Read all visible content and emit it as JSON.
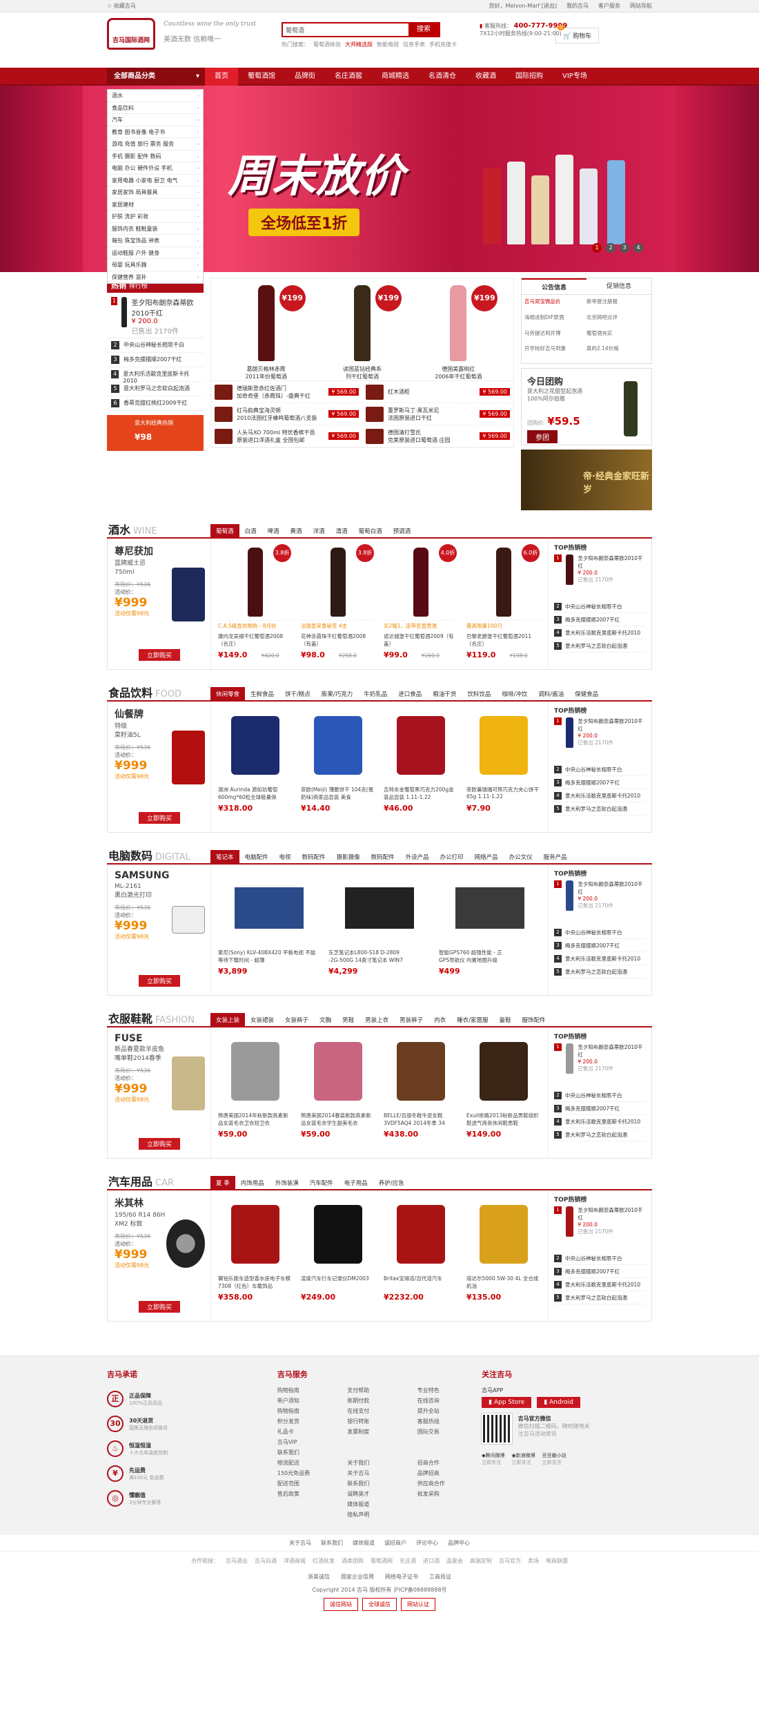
{
  "topbar": {
    "fav": "收藏吉马",
    "links": [
      "您好，Melvon-Marf [退出]",
      "我的吉马",
      "客户服务",
      "网站导航"
    ]
  },
  "header": {
    "logo": "吉马国际酒网",
    "slogan": "Countless wine the only trust",
    "slogan2": "美酒无数 信赖唯一",
    "search_value": "葡萄酒",
    "search_btn": "搜索",
    "hot_label": "热门搜索：",
    "hot": [
      "葡萄酒体验",
      "大师精选版",
      "智能电视",
      "信息手表",
      "手机充值卡"
    ],
    "phone_label": "客服热线：",
    "phone": "400-777-9999",
    "phone_time": "7X12小时服务热线(9:00-21:00)",
    "cart": "购物车",
    "cart_count": "0"
  },
  "nav": {
    "cat": "全部商品分类",
    "items": [
      "首页",
      "葡萄酒馆",
      "品牌街",
      "名庄酒窖",
      "商城精选",
      "名酒清仓",
      "收藏酒",
      "国际招购",
      "VIP专场"
    ]
  },
  "categories": [
    "酒水",
    "食品饮料",
    "汽车",
    "教育 图书音像 电子书",
    "游戏 充值 旅行 票务 服务",
    "手机 摄影 配件 数码",
    "电脑 办公 硬件外设 手机",
    "家用电器 小家电 厨卫 电气",
    "家居家饰 局具餐具",
    "家居建材",
    "护肤 洗护 彩妆",
    "服饰内衣 鞋靴童装",
    "箱包 珠宝饰品 钟表",
    "运动鞋服 户外 健身",
    "母婴 玩具乐器",
    "保健营养 滋补"
  ],
  "banner": {
    "title": "周末放价",
    "sub": "全场低至1折",
    "dots": [
      "1",
      "2",
      "3",
      "4"
    ]
  },
  "rank": {
    "title": "热销",
    "title2": "排行榜",
    "first": {
      "name": "圣夕阳布朗奈森蒂欧2010干红",
      "price": "¥ 200.0",
      "sold": "已售出 2170件"
    },
    "items": [
      "中央山谷神秘长相思干白",
      "梅多克摆摆顺2007干红",
      "意大利乐活歌克里底斯卡托2010",
      "意大利罗马之恋软白起泡酒",
      "香蒂克甜红桃红2009干红"
    ],
    "promo_title": "意大利经典热销",
    "promo_price": "¥98"
  },
  "promo": {
    "main": [
      {
        "price": "¥199",
        "name": "葛朗贝格林赤霞\n2011年份葡萄酒"
      },
      {
        "price": "¥199",
        "name": "读国蓝钻经典系\n列干红葡萄酒"
      },
      {
        "price": "¥199",
        "name": "德国美露桃红\n2006年干红葡萄酒"
      }
    ],
    "small": [
      {
        "name": "德瑞斯登赤红佐酒门\n加奇奇堡（赤霞珠）-盛典干红",
        "price": "¥ 569.00"
      },
      {
        "name": "红木酒柜",
        "price": "¥ 569.00"
      },
      {
        "name": "红马韵典宝海灵顿\n2010法国红牙蜂鸣葡萄酒八支装",
        "price": "¥ 569.00"
      },
      {
        "name": "董罗斯马丁·黑瓦米尼\n法国原装进口干红",
        "price": "¥ 569.00"
      },
      {
        "name": "人头马XO 700ml 特优香槟干邑\n原装进口洋酒礼盒 全国包邮",
        "price": "¥ 569.00"
      },
      {
        "name": "德国清打雪氏\n克莱原装进口葡萄酒 庄园",
        "price": "¥ 569.00"
      }
    ]
  },
  "side": {
    "tabs": [
      "公告信息",
      "促销信息"
    ],
    "news": [
      "吉马双宝微品价",
      "新帝登注册报",
      "海棉进制DIF原酒",
      "北京网吧点评",
      "马劳提达到开博",
      "葡萄酒充实",
      "开学校好吉马到惠",
      "真的2.14价格"
    ],
    "tuan_title": "今日团购",
    "tuan_desc": "意大利之花甜型起泡酒\n100%阿尔伯雅",
    "tuan_label": "团购价",
    "tuan_price": "¥59.5",
    "tuan_btn": "参团",
    "gold": "帝·经典金家旺新岁"
  },
  "sections": [
    {
      "title": "酒水",
      "en": "WINE",
      "tabs": [
        "葡萄酒",
        "白酒",
        "啤酒",
        "黄酒",
        "洋酒",
        "清酒",
        "葡萄白酒",
        "预调酒"
      ],
      "feat": {
        "name": "尊尼获加",
        "desc": "蓝牌威士忌\n750ml",
        "market": "市场价：¥536",
        "act": "活动价：",
        "price": "¥999",
        "note": "活动仅需98元"
      },
      "buy": "立即购买",
      "goods": [
        {
          "badge": "3.8折",
          "desc": "康内龙吴裙干红葡萄酒2008（名庄）",
          "price": "¥149.0",
          "old": "¥420.0",
          "ad": "C.A.S级直供限购 - 8月份"
        },
        {
          "badge": "3.8折",
          "desc": "花神赤霞珠干红葡萄酒2008（有盖）",
          "price": "¥98.0",
          "old": "¥258.0",
          "ad": "法国直采意秘芳 4支"
        },
        {
          "badge": "4.0折",
          "desc": "诺达城堡干红葡萄酒2009（有盖）",
          "price": "¥99.0",
          "old": "¥260.0",
          "ad": "买2赠1，连带至直营酒"
        },
        {
          "badge": "6.0折",
          "desc": "巴黎老爵堡干红葡萄酒2011（名庄）",
          "price": "¥119.0",
          "old": "¥198.0",
          "ad": "最高限量100只"
        }
      ],
      "top": {
        "name": "圣夕阳布朗奈森蒂欧2010干红",
        "price": "¥ 200.0",
        "sold": "已售出 2170件",
        "items": [
          "中央山谷神秘长相思干白",
          "梅多克摆摆顺2007干红",
          "意大利乐活歌克里底斯卡托2010",
          "意大利罗马之恋软白起泡酒"
        ]
      }
    },
    {
      "title": "食品饮料",
      "en": "FOOD",
      "tabs": [
        "休闲零食",
        "生鲜食品",
        "饼干/糕点",
        "膨果/巧克力",
        "牛奶乳品",
        "进口食品",
        "粮油干货",
        "饮料饮品",
        "咖啡/冲饮",
        "调料/酱油",
        "保健食品"
      ],
      "feat": {
        "name": "仙餐牌",
        "desc": "特级\n菜籽油5L",
        "market": "市场价：¥536",
        "act": "活动价：",
        "price": "¥999",
        "note": "活动仅需98元"
      },
      "buy": "立即购买",
      "goods": [
        {
          "badge": "",
          "desc": "澳洲 Aurinda 源如坊葡萄 600mg*60粒全球极量保",
          "price": "¥318.00",
          "old": "",
          "ad": ""
        },
        {
          "badge": "",
          "desc": "菲欧(Meiji) 薄脆饼干 104克(蛋奶味)商家品尝装 美食",
          "price": "¥14.40",
          "old": "",
          "ad": ""
        },
        {
          "badge": "",
          "desc": "吉特本金葡萄黑巧克力200g盒装品尝装 1.11-1.22",
          "price": "¥46.00",
          "old": "",
          "ad": ""
        },
        {
          "badge": "",
          "desc": "菲欧兼瑞瑞可熊巧克力夹心饼干 65g 1.11-1.22",
          "price": "¥7.90",
          "old": "",
          "ad": ""
        }
      ],
      "top": {
        "name": "圣夕阳布朗奈森蒂欧2010干红",
        "price": "¥ 200.0",
        "sold": "已售出 2170件",
        "items": [
          "中央山谷神秘长相思干白",
          "梅多克摆摆顺2007干红",
          "意大利乐活歌克里底斯卡托2010",
          "意大利罗马之恋软白起泡酒"
        ]
      }
    },
    {
      "title": "电脑数码",
      "en": "DIGITAL",
      "tabs": [
        "笔记本",
        "电脑配件",
        "电视",
        "数码配件",
        "摄影摄像",
        "数码配件",
        "外设产品",
        "办公打印",
        "网络产品",
        "办公文仪",
        "服务产品"
      ],
      "feat": {
        "name": "SAMSUNG",
        "desc": "ML-2161\n黑白激光打印",
        "market": "市场价：¥536",
        "act": "活动价：",
        "price": "¥999",
        "note": "活动仅需98元"
      },
      "buy": "立即购买",
      "goods": [
        {
          "badge": "",
          "desc": "索尼(Sony) KLV-40BX420 平板电视 不能等待下载时间 - 超薄",
          "price": "¥3,899",
          "old": "",
          "ad": ""
        },
        {
          "badge": "",
          "desc": "东芝笔记本L800-S18 D-2809\n-2G-500G 14英寸笔记本 WIN7",
          "price": "¥4,299",
          "old": "",
          "ad": ""
        },
        {
          "badge": "",
          "desc": "智能GPS760 超强性能 - 正\nGPS导航仪 内置地图升级",
          "price": "¥499",
          "old": "",
          "ad": ""
        }
      ],
      "top": {
        "name": "圣夕阳布朗奈森蒂欧2010干红",
        "price": "¥ 200.0",
        "sold": "已售出 2170件",
        "items": [
          "中央山谷神秘长相思干白",
          "梅多克摆摆顺2007干红",
          "意大利乐活歌克里底斯卡托2010",
          "意大利罗马之恋软白起泡酒"
        ]
      }
    },
    {
      "title": "衣服鞋靴",
      "en": "FASHION",
      "tabs": [
        "女装上装",
        "女装裙装",
        "女装裤子",
        "文胸",
        "男鞋",
        "男装上衣",
        "男装裤子",
        "内衣",
        "睡衣/家居服",
        "童鞋",
        "服饰配件"
      ],
      "feat": {
        "name": "FUSE",
        "desc": "新品春夏款羊皮鱼\n嘴单鞋2014春季",
        "market": "市场价：¥536",
        "act": "活动价：",
        "price": "¥999",
        "note": "活动仅需98元"
      },
      "buy": "立即购买",
      "goods": [
        {
          "badge": "",
          "desc": "熊唐美国2014年秋新款高素新品女装毛衣卫衣短卫衣",
          "price": "¥59.00",
          "old": "",
          "ad": ""
        },
        {
          "badge": "",
          "desc": "熊唐美国2014春装新款高素新品女装毛衣学生甜美毛衣",
          "price": "¥59.00",
          "old": "",
          "ad": ""
        },
        {
          "badge": "",
          "desc": "BELLE/百丽冬靴牛皮女靴3VDF5AQ4 2014冬季 34",
          "price": "¥438.00",
          "old": "",
          "ad": ""
        },
        {
          "badge": "",
          "desc": "Exull依路2013秋新品男鞋组织鞋透气商务休闲鞋男鞋",
          "price": "¥149.00",
          "old": "",
          "ad": ""
        }
      ],
      "top": {
        "name": "圣夕阳布朗奈森蒂欧2010干红",
        "price": "¥ 200.0",
        "sold": "已售出 2170件",
        "items": [
          "中央山谷神秘长相思干白",
          "梅多克摆摆顺2007干红",
          "意大利乐活歌克里底斯卡托2010",
          "意大利罗马之恋软白起泡酒"
        ]
      }
    },
    {
      "title": "汽车用品",
      "en": "CAR",
      "tabs": [
        "夏 季",
        "内饰用品",
        "外饰装潢",
        "汽车配件",
        "电子用品",
        "养护/应急"
      ],
      "feat": {
        "name": "米其林",
        "desc": "195/60 R14 86H\nXM2 标致",
        "market": "市场价：¥536",
        "act": "活动价：",
        "price": "¥999",
        "note": "活动仅需98元"
      },
      "buy": "立即购买",
      "goods": [
        {
          "badge": "",
          "desc": "赛铂乐跑车造型香水座电子车模7308（红色）车载饰品",
          "price": "¥358.00",
          "old": "",
          "ad": ""
        },
        {
          "badge": "",
          "desc": "凌度汽车行车记录仪DM2003",
          "price": "¥249.00",
          "old": "",
          "ad": ""
        },
        {
          "badge": "",
          "desc": "Britax宝得适/百代适汽车",
          "price": "¥2232.00",
          "old": "",
          "ad": ""
        },
        {
          "badge": "",
          "desc": "道达尔5000 5W-30 4L 全合成机油",
          "price": "¥135.00",
          "old": "",
          "ad": ""
        }
      ],
      "top": {
        "name": "圣夕阳布朗奈森蒂欧2010干红",
        "price": "¥ 200.0",
        "sold": "已售出 2170件",
        "items": [
          "中央山谷神秘长相思干白",
          "梅多克摆摆顺2007干红",
          "意大利乐活歌克里底斯卡托2010",
          "意大利罗马之恋软白起泡酒"
        ]
      }
    }
  ],
  "footer": {
    "c1": "吉马承诺",
    "promises": [
      {
        "c": "正",
        "t": "正品保障",
        "s": "100%正品货品"
      },
      {
        "c": "30",
        "t": "30天退货",
        "s": "国美无理由退换货"
      },
      {
        "c": "♨",
        "t": "恒温恒湿",
        "s": "十大仓库温度控制"
      },
      {
        "c": "¥",
        "t": "先运费",
        "s": "满100元 免运费"
      },
      {
        "c": "◎",
        "t": "懂靓值",
        "s": "3分钟专业解答"
      }
    ],
    "c2": "吉马服务",
    "links": [
      "购物指南",
      "支付帮助",
      "专业特色",
      "新户须知",
      "账期付款",
      "在线咨询",
      "购物指南",
      "在线支付",
      "提升全站",
      "积分发货",
      "银行转账",
      "客服热线",
      "礼品卡",
      "发票制度",
      "国际交易",
      "吉马VIP",
      "",
      "",
      "联系我们",
      "",
      "",
      "物流配送",
      "关于我们",
      "招商合作",
      "150元免运费",
      "关于吉马",
      "品牌招商",
      "配送范围",
      "联系我们",
      "供应商合作",
      "售后政策",
      "诚聘英才",
      "批发采购",
      "",
      "媒体报道",
      "",
      "",
      "隐私声明",
      ""
    ],
    "c3": "关注吉马",
    "app": "吉马APP",
    "appstore": "App Store",
    "android": "Android",
    "qr_desc": "吉马官方微信",
    "qr_sub": "微信扫描二维码，随时随地关注吉马活动资讯",
    "follows": [
      "腾讯微博",
      "新浪微博",
      "豆瓣小站"
    ],
    "follow_btn": "立即关注"
  },
  "bottom": {
    "l1": [
      "关于吉马",
      "联系我们",
      "媒体报道",
      "诚招商户",
      "评论中心",
      "品牌中心"
    ],
    "l2": [
      "合作链接：",
      "吉马酒业",
      "吉马白酒",
      "洋酒商城",
      "红酒批发",
      "酒类团购",
      "葡萄酒网",
      "名庄酒",
      "进口酒",
      "品鉴会",
      "高端定制",
      "吉马官方",
      "卖场",
      "电商联盟"
    ],
    "certs": [
      "浙美诚信",
      "国家企业信用",
      "网络电子证书",
      "工商局证"
    ],
    "copyright": "Copyright 2014 吉马 版权所有",
    "icp": "沪ICP备08888888号",
    "badges": [
      "诚信网站",
      "全球诚信",
      "网站认证"
    ]
  }
}
